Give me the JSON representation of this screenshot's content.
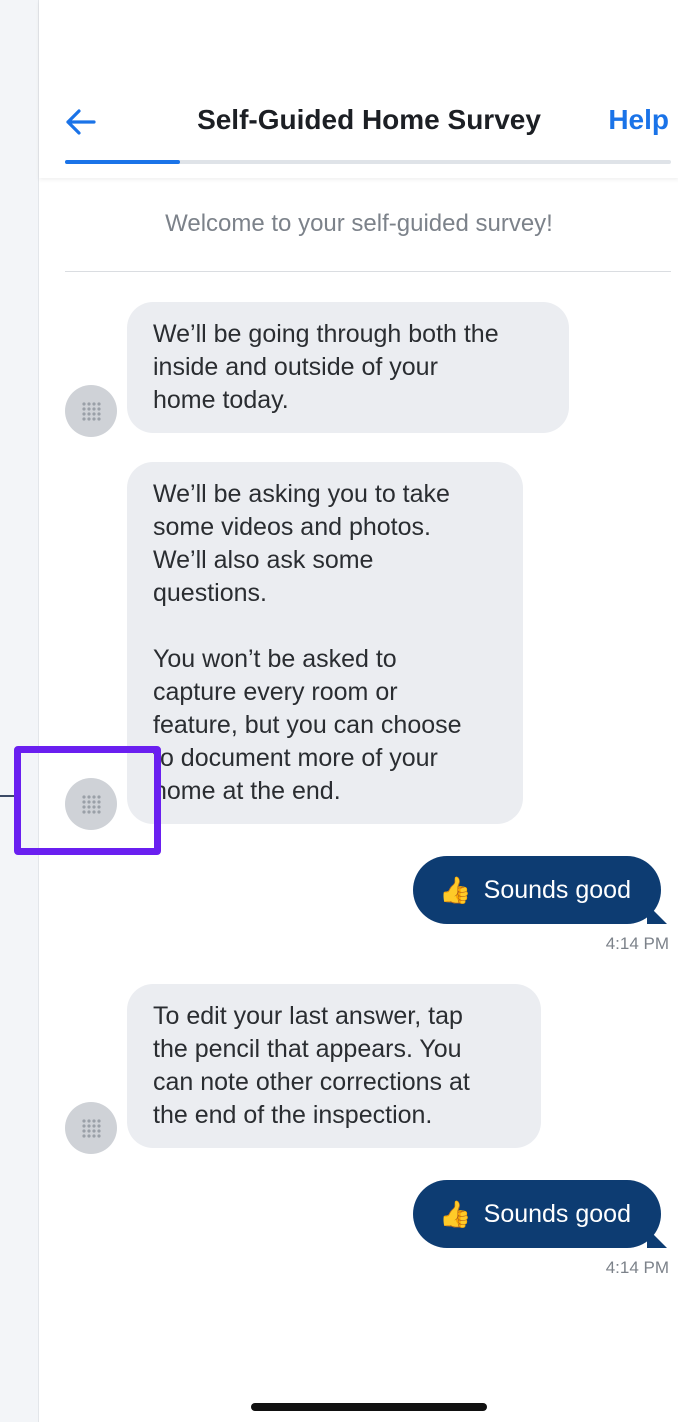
{
  "header": {
    "title": "Self-Guided Home Survey",
    "help_label": "Help",
    "back_icon": "arrow-left-icon",
    "progress": 0.19,
    "accent_color": "#1a73e8"
  },
  "chat": {
    "welcome": "Welcome to your self-guided survey!",
    "messages": [
      {
        "type": "bot",
        "text": "We’ll be going through both the\ninside and outside of your\nhome today."
      },
      {
        "type": "bot",
        "text": "We’ll be asking you to take\nsome videos and photos.\nWe’ll also ask some\nquestions.\n\nYou won’t be asked to\ncapture every room or\nfeature, but you can choose\nto document more of your\nhome at the end."
      },
      {
        "type": "user",
        "emoji": "👍",
        "text": "Sounds good",
        "time": "4:14 PM"
      },
      {
        "type": "bot",
        "text": "To edit your last answer, tap\nthe pencil that appears. You\ncan note other corrections at\nthe end of the inspection."
      },
      {
        "type": "user",
        "emoji": "👍",
        "text": "Sounds good",
        "time": "4:14 PM"
      }
    ]
  },
  "colors": {
    "user_bubble": "#0d3c72",
    "bot_bubble": "#ebedf1",
    "highlight": "#6a1ff0"
  }
}
